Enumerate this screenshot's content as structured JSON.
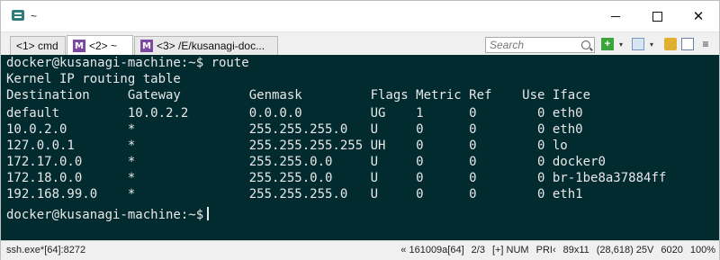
{
  "window": {
    "title": "~"
  },
  "tabs": [
    {
      "label": "<1> cmd"
    },
    {
      "label": "<2> ~"
    },
    {
      "label": "<3> /E/kusanagi-doc..."
    }
  ],
  "toolbar": {
    "search_placeholder": "Search",
    "add_label": "+",
    "add_dropdown": "▾",
    "view_dropdown": "▾",
    "menu": "≡"
  },
  "console": {
    "lines": [
      "docker@kusanagi-machine:~$ route",
      "Kernel IP routing table",
      "Destination     Gateway         Genmask         Flags Metric Ref    Use Iface",
      "default         10.0.2.2        0.0.0.0         UG    1      0        0 eth0",
      "10.0.2.0        *               255.255.255.0   U     0      0        0 eth0",
      "127.0.0.1       *               255.255.255.255 UH    0      0        0 lo",
      "172.17.0.0      *               255.255.0.0     U     0      0        0 docker0",
      "172.18.0.0      *               255.255.0.0     U     0      0        0 br-1be8a37884ff",
      "192.168.99.0    *               255.255.255.0   U     0      0        0 eth1",
      "docker@kusanagi-machine:~$"
    ]
  },
  "statusbar": {
    "process": "ssh.exe*[64]:8272",
    "items": [
      "« 161009a[64]",
      "2/3",
      "[+] NUM",
      "PRI‹",
      "89x11",
      "(28,618) 25V",
      "6020",
      "100%"
    ]
  }
}
